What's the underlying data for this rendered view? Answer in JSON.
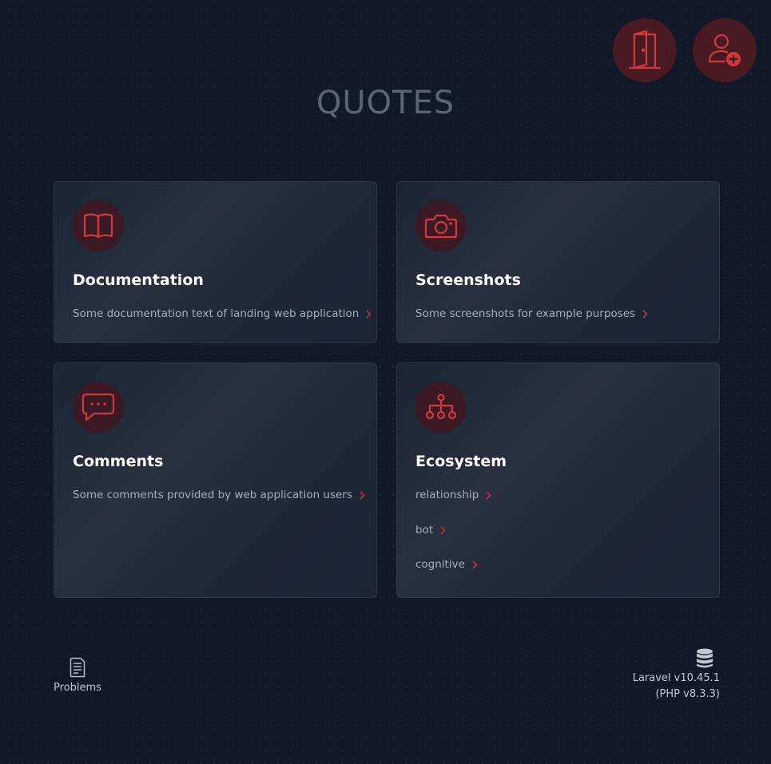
{
  "header": {
    "title": "QUOTES"
  },
  "cards": [
    {
      "title": "Documentation",
      "icon": "book-icon",
      "links": [
        "Some documentation text of landing web application"
      ]
    },
    {
      "title": "Screenshots",
      "icon": "camera-icon",
      "links": [
        "Some screenshots for example purposes"
      ]
    },
    {
      "title": "Comments",
      "icon": "chat-icon",
      "links": [
        "Some comments provided by web application users"
      ]
    },
    {
      "title": "Ecosystem",
      "icon": "network-icon",
      "links": [
        "relationship",
        "bot",
        "cognitive"
      ]
    }
  ],
  "footer": {
    "problems_label": "Problems",
    "version": "Laravel v10.45.1",
    "php_version": "(PHP v8.3.3)"
  },
  "colors": {
    "accent": "#dc2626",
    "background": "#111827",
    "card": "#172030",
    "icon_bg": "#3b1a25"
  }
}
